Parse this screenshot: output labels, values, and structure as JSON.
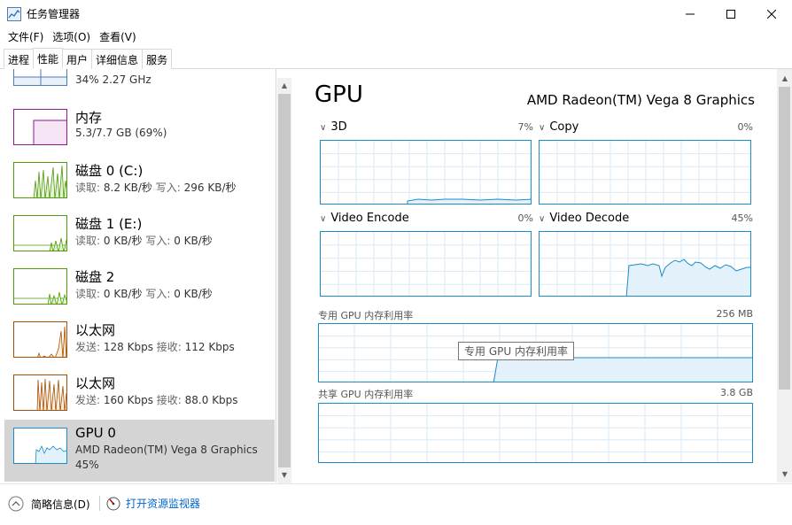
{
  "window": {
    "title": "任务管理器"
  },
  "menu": {
    "items": [
      "文件(F)",
      "选项(O)",
      "查看(V)"
    ]
  },
  "tabs": [
    "进程",
    "性能",
    "用户",
    "详细信息",
    "服务"
  ],
  "sidebar": {
    "items": [
      {
        "name": "",
        "detail": "34% 2.27 GHz",
        "color": "#4b7fb3"
      },
      {
        "name": "内存",
        "detail": "5.3/7.7 GB (69%)",
        "color": "#8b1a8b"
      },
      {
        "name": "磁盘 0 (C:)",
        "read_label": "读取:",
        "read": "8.2 KB/秒",
        "write_label": "写入:",
        "write": "296 KB/秒",
        "color": "#4d9a06"
      },
      {
        "name": "磁盘 1 (E:)",
        "read_label": "读取:",
        "read": "0 KB/秒",
        "write_label": "写入:",
        "write": "0 KB/秒",
        "color": "#4d9a06"
      },
      {
        "name": "磁盘 2",
        "read_label": "读取:",
        "read": "0 KB/秒",
        "write_label": "写入:",
        "write": "0 KB/秒",
        "color": "#4d9a06"
      },
      {
        "name": "以太网",
        "send_label": "发送:",
        "send": "128 Kbps",
        "recv_label": "接收:",
        "recv": "112 Kbps",
        "color": "#a74f01"
      },
      {
        "name": "以太网",
        "send_label": "发送:",
        "send": "160 Kbps",
        "recv_label": "接收:",
        "recv": "88.0 Kbps",
        "color": "#a74f01"
      },
      {
        "name": "GPU 0",
        "detail": "AMD Radeon(TM) Vega 8 Graphics",
        "pct": "45%",
        "color": "#1a8cc7"
      }
    ]
  },
  "main": {
    "title": "GPU",
    "model": "AMD Radeon(TM) Vega 8 Graphics",
    "engines": [
      {
        "name": "3D",
        "pct": "7%"
      },
      {
        "name": "Copy",
        "pct": "0%"
      },
      {
        "name": "Video Encode",
        "pct": "0%"
      },
      {
        "name": "Video Decode",
        "pct": "45%"
      }
    ],
    "dedicated": {
      "label": "专用 GPU 内存利用率",
      "max": "256 MB"
    },
    "shared": {
      "label": "共享 GPU 内存利用率",
      "max": "3.8 GB"
    },
    "tooltip": "专用 GPU 内存利用率"
  },
  "footer": {
    "less_details": "简略信息(D)",
    "open_monitor": "打开资源监视器"
  }
}
